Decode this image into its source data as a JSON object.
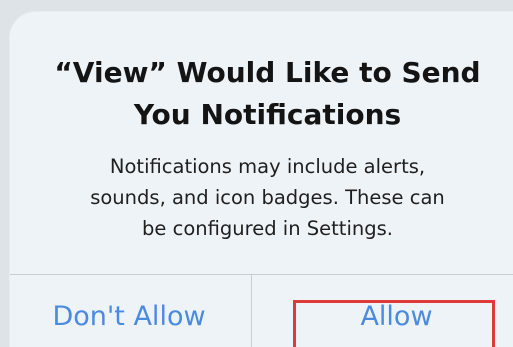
{
  "alert": {
    "title_line1": "“View” Would Like to Send",
    "title_line2": "You Notifications",
    "message_line1": "Notifications may include alerts,",
    "message_line2": "sounds, and icon badges. These can",
    "message_line3": "be configured in Settings."
  },
  "buttons": {
    "dont_allow": "Don't Allow",
    "allow": "Allow"
  },
  "colors": {
    "button_text": "#4a8be0",
    "highlight": "#e0393a",
    "title_text": "#141414",
    "alert_background": "#eef3f7"
  }
}
